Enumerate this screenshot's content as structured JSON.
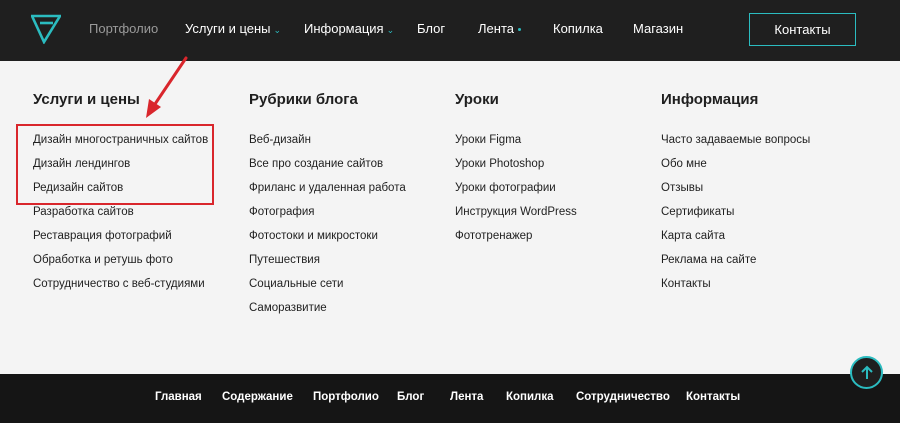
{
  "header": {
    "logo_icon": "logo-icon",
    "nav": [
      {
        "label": "Портфолио",
        "muted": true
      },
      {
        "label": "Услуги и цены",
        "dropdown": true
      },
      {
        "label": "Информация",
        "dropdown": true
      },
      {
        "label": "Блог"
      },
      {
        "label": "Лента",
        "badge_dot": true
      },
      {
        "label": "Копилка"
      },
      {
        "label": "Магазин"
      }
    ],
    "contacts_button": "Контакты",
    "accent_color": "#2bbcc0"
  },
  "menu": {
    "columns": [
      {
        "title": "Услуги и цены",
        "items": [
          "Дизайн многостраничных сайтов",
          "Дизайн лендингов",
          "Редизайн сайтов",
          "Разработка сайтов",
          "Реставрация фотографий",
          "Обработка и ретушь фото",
          "Сотрудничество с веб-студиями"
        ]
      },
      {
        "title": "Рубрики блога",
        "items": [
          "Веб-дизайн",
          "Все про создание сайтов",
          "Фриланс и удаленная работа",
          "Фотография",
          "Фотостоки и микростоки",
          "Путешествия",
          "Социальные сети",
          "Саморазвитие"
        ]
      },
      {
        "title": "Уроки",
        "items": [
          "Уроки Figma",
          "Уроки Photoshop",
          "Уроки фотографии",
          "Инструкция WordPress",
          "Фототренажер"
        ]
      },
      {
        "title": "Информация",
        "items": [
          "Часто задаваемые вопросы",
          "Обо мне",
          "Отзывы",
          "Сертификаты",
          "Карта сайта",
          "Реклама на сайте",
          "Контакты"
        ]
      }
    ],
    "annotation_color": "#d9262c"
  },
  "footer": {
    "nav": [
      "Главная",
      "Содержание",
      "Портфолио",
      "Блог",
      "Лента",
      "Копилка",
      "Сотрудничество",
      "Контакты"
    ]
  },
  "scroll_top_icon": "arrow-up-icon"
}
